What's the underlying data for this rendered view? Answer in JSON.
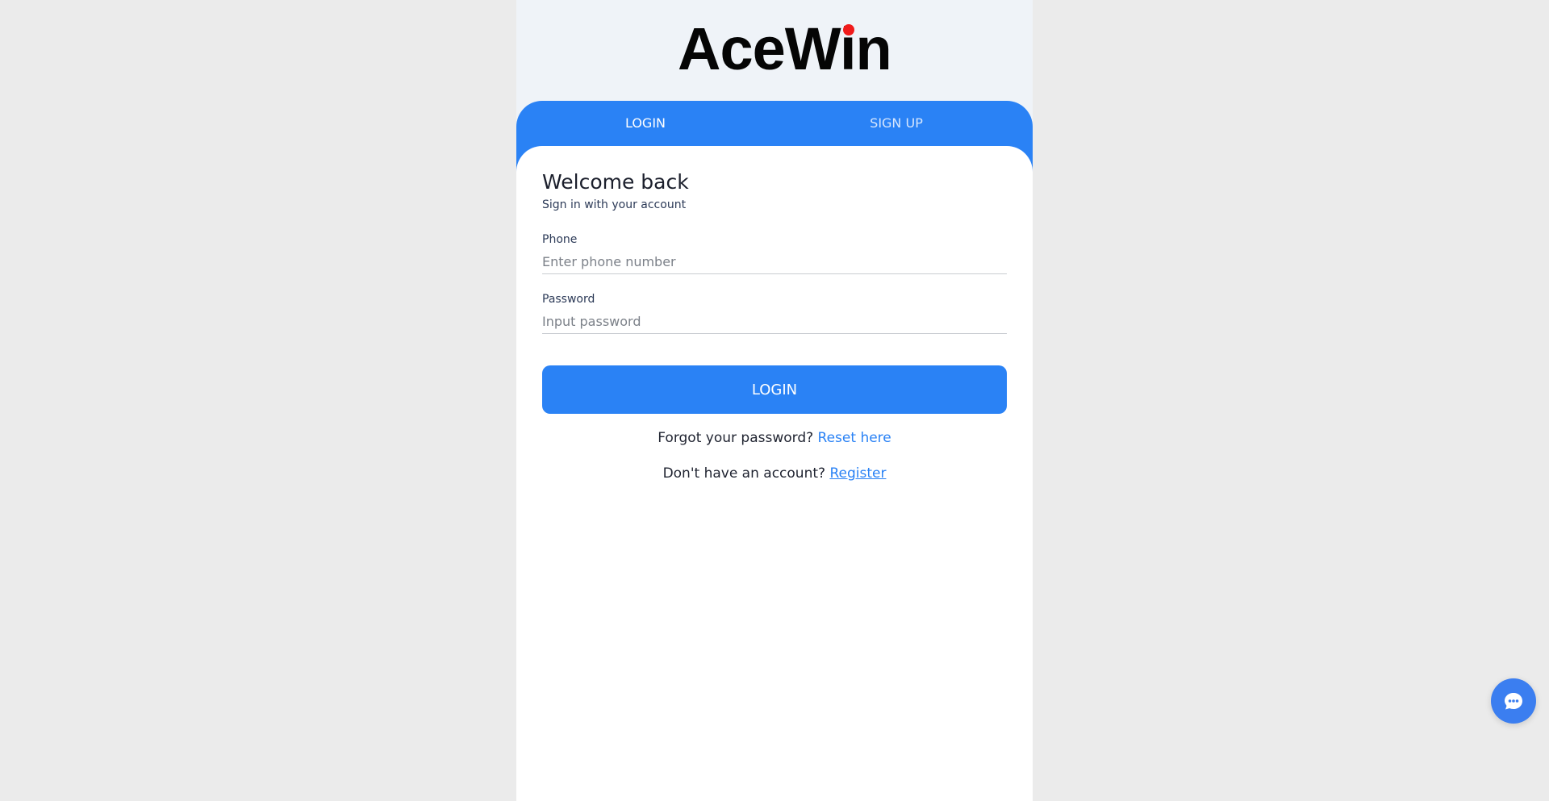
{
  "brand": {
    "logo_text": "AceWin",
    "accent_color": "#2a82f5",
    "logo_dot_color": "#f01b1b"
  },
  "tabs": [
    {
      "label": "LOGIN",
      "active": true
    },
    {
      "label": "SIGN UP",
      "active": false
    }
  ],
  "form": {
    "title": "Welcome back",
    "subtitle": "Sign in with your account",
    "phone": {
      "label": "Phone",
      "placeholder": "Enter phone number",
      "value": ""
    },
    "password": {
      "label": "Password",
      "placeholder": "Input password",
      "value": ""
    },
    "submit_label": "LOGIN"
  },
  "help": {
    "forgot_text": "Forgot your password? ",
    "reset_link": "Reset here",
    "no_account_text": "Don't have an account? ",
    "register_link": "Register"
  },
  "chat_button": {
    "icon": "chat-bubble-icon"
  }
}
